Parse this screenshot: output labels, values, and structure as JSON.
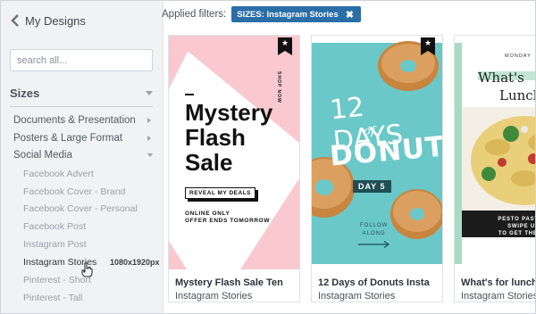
{
  "sidebar": {
    "back_label": "My Designs",
    "search_placeholder": "search all...",
    "sizes_heading": "Sizes",
    "categories": [
      {
        "label": "Documents & Presentation"
      },
      {
        "label": "Posters & Large Format"
      },
      {
        "label": "Social Media"
      }
    ],
    "social_items": [
      {
        "label": "Facebook Advert"
      },
      {
        "label": "Facebook Cover - Brand"
      },
      {
        "label": "Facebook Cover - Personal"
      },
      {
        "label": "Facebook Post"
      },
      {
        "label": "Instagram Post"
      },
      {
        "label": "Instagram Stories",
        "dims": "1080x1920px"
      },
      {
        "label": "Pinterest - Short"
      },
      {
        "label": "Pinterest - Tall"
      }
    ]
  },
  "filters": {
    "label": "Applied filters:",
    "chip": "SIZES: Instagram Stories",
    "chip_remove": "✖"
  },
  "cards": [
    {
      "title": "Mystery Flash Sale Ten",
      "subtitle": "Instagram Stories",
      "thumb": {
        "line1": "Mystery",
        "line2": "Flash",
        "line3": "Sale",
        "button": "REVEAL MY DEALS",
        "small1": "ONLINE ONLY",
        "small2": "OFFER ENDS TOMORROW",
        "vertical": "SHOP NOW"
      }
    },
    {
      "title": "12 Days of Donuts Insta",
      "subtitle": "Instagram Stories",
      "thumb": {
        "days": "12 DAYS",
        "of": "of",
        "donut": "DONUT",
        "day": "DAY 5",
        "follow1": "FOLLOW",
        "follow2": "ALONG"
      }
    },
    {
      "title": "What's for lunch -",
      "subtitle": "Instagram Stories",
      "thumb": {
        "monday": "MONDAY",
        "whats": "What's",
        "lunch": "Lunch",
        "pesto1": "PESTO PASTA S",
        "pesto2": "SWIPE UP",
        "pesto3": "TO GET THE RE"
      }
    }
  ],
  "colors": {
    "accent": "#2a6ea8",
    "pink": "#f9c9cf",
    "teal": "#6ac8c8",
    "mint": "#a6dcc5"
  }
}
